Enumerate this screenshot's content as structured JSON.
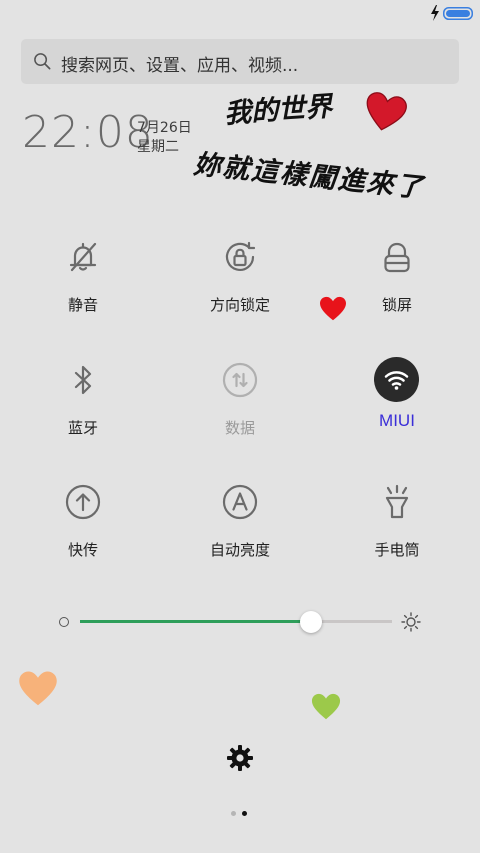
{
  "status_bar": {
    "icons": [
      "charging-icon",
      "battery-icon"
    ],
    "battery_color": "#3a7fe0"
  },
  "search": {
    "placeholder": "搜索网页、设置、应用、视频..."
  },
  "clock": {
    "time": "22:08",
    "date": "7月26日",
    "weekday": "星期二"
  },
  "wallpaper_text": {
    "line1": "我的世界",
    "line2": "妳就這樣闖進來了"
  },
  "tiles": [
    {
      "label": "静音",
      "icon": "bell-off-icon"
    },
    {
      "label": "方向锁定",
      "icon": "rotation-lock-icon"
    },
    {
      "label": "锁屏",
      "icon": "lock-icon"
    },
    {
      "label": "蓝牙",
      "icon": "bluetooth-icon"
    },
    {
      "label": "数据",
      "icon": "mobile-data-icon",
      "state": "disabled"
    },
    {
      "label": "MIUI",
      "icon": "wifi-icon",
      "state": "active"
    },
    {
      "label": "快传",
      "icon": "quick-transfer-icon"
    },
    {
      "label": "自动亮度",
      "icon": "auto-brightness-icon"
    },
    {
      "label": "手电筒",
      "icon": "flashlight-icon"
    }
  ],
  "brightness": {
    "level": 0.74,
    "fill_color": "#2e9e5a"
  },
  "colors": {
    "accent": "#3a2ed8",
    "heart_red": "#e8131a",
    "heart_orange": "#f7b27a",
    "heart_green": "#9cc94a"
  },
  "pager": {
    "pages": 2,
    "current": 2
  }
}
